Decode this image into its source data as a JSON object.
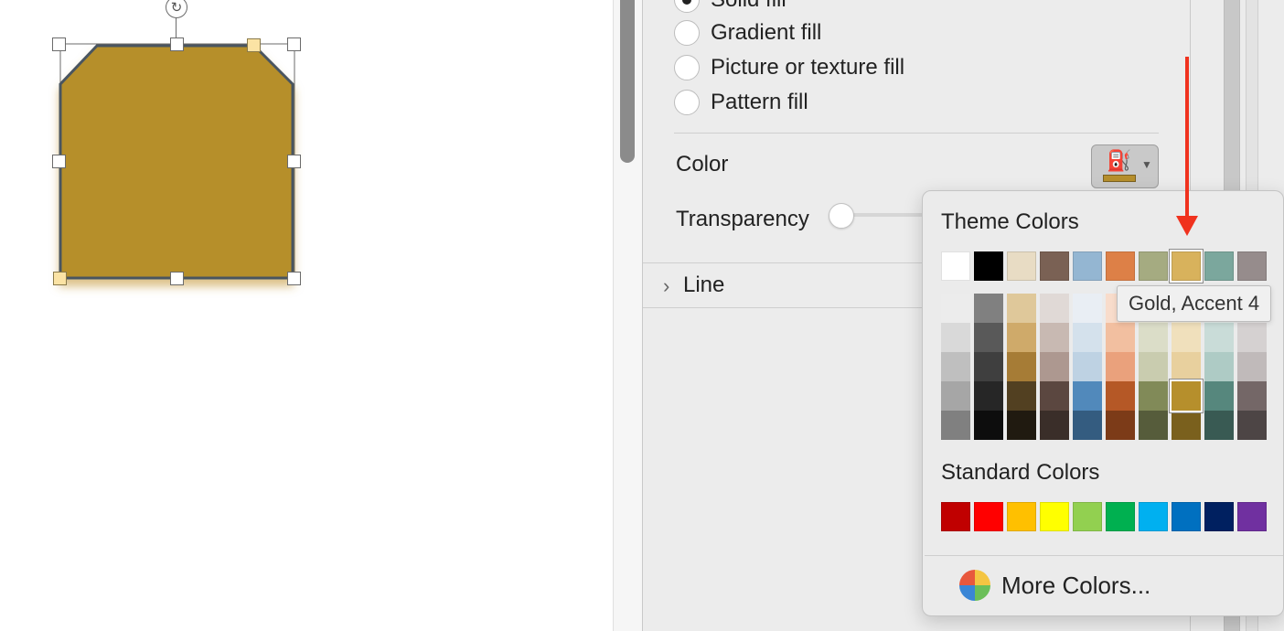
{
  "fill_options": {
    "solid_fill": "Solid fill",
    "gradient_fill": "Gradient fill",
    "picture_fill": "Picture or texture fill",
    "pattern_fill": "Pattern fill",
    "selected": "Solid fill"
  },
  "color_label": "Color",
  "transparency_label": "Transparency",
  "line_section": "Line",
  "current_fill_color": "#b68f2c",
  "icons": {
    "color_button": "paint-bucket-icon",
    "dropdown": "chevron-down-icon",
    "line_expand": "chevron-right-icon",
    "rotate": "rotate-icon",
    "more_colors": "color-wheel-icon"
  },
  "palette": {
    "theme_title": "Theme Colors",
    "standard_title": "Standard Colors",
    "more_colors": "More Colors...",
    "tooltip": "Gold, Accent 4",
    "theme_colors": [
      "#ffffff",
      "#000000",
      "#e8dcc4",
      "#7a6154",
      "#94b6d2",
      "#dd8047",
      "#a5ab81",
      "#d8b25c",
      "#7ba79d",
      "#968c8c"
    ],
    "theme_tints": [
      [
        "#ececec",
        "#d9d9d9",
        "#bfbfbf",
        "#a6a6a6",
        "#808080"
      ],
      [
        "#808080",
        "#595959",
        "#3f3f3f",
        "#262626",
        "#0d0d0d"
      ],
      [
        "#dfc89a",
        "#cfaa6a",
        "#a67c36",
        "#524021",
        "#201a10"
      ],
      [
        "#e0d9d6",
        "#c8b9b2",
        "#ad9890",
        "#5b4740",
        "#3a2e29"
      ],
      [
        "#e9eef4",
        "#d4e1ec",
        "#bed2e3",
        "#5189bb",
        "#345c80"
      ],
      [
        "#f8dccb",
        "#f2bfa0",
        "#eaa17c",
        "#b55826",
        "#7c3b18"
      ],
      [
        "#ededde",
        "#dbddc8",
        "#c9ccaf",
        "#818a58",
        "#565c3b"
      ],
      [
        "#f7efdc",
        "#f0e0bc",
        "#e8d09e",
        "#b68f2c",
        "#7a601d"
      ],
      [
        "#e4eeec",
        "#c9dcd8",
        "#aecbc5",
        "#56877d",
        "#395a53"
      ],
      [
        "#eae8e8",
        "#d5d1d1",
        "#c0baba",
        "#746767",
        "#4d4545"
      ]
    ],
    "selected_tint": [
      7,
      3
    ],
    "standard_colors": [
      "#c00000",
      "#ff0000",
      "#ffc000",
      "#ffff00",
      "#92d050",
      "#00b050",
      "#00b0f0",
      "#0070c0",
      "#002060",
      "#7030a0"
    ],
    "highlighted_theme_index": 7
  }
}
